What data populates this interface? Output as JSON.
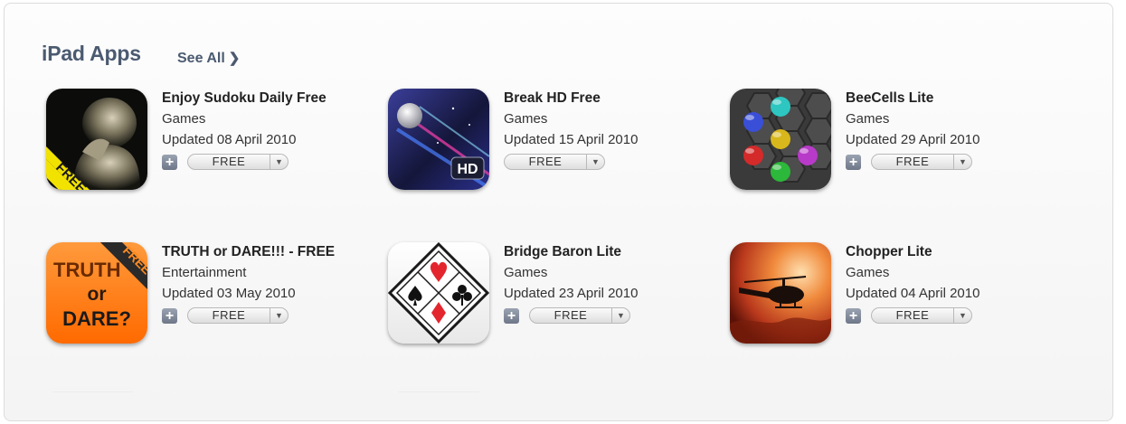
{
  "section": {
    "title": "iPad Apps",
    "see_all": "See All",
    "see_all_icon": "chevron-right-icon"
  },
  "apps": [
    {
      "name": "Enjoy Sudoku Daily Free",
      "category": "Games",
      "updated": "Updated 08 April 2010",
      "price": "FREE",
      "badge": "FREE",
      "has_plus": true
    },
    {
      "name": "Break HD Free",
      "category": "Games",
      "updated": "Updated 15 April 2010",
      "price": "FREE",
      "badge": "HD",
      "has_plus": false
    },
    {
      "name": "BeeCells Lite",
      "category": "Games",
      "updated": "Updated 29 April 2010",
      "price": "FREE",
      "has_plus": true
    },
    {
      "name": "TRUTH or DARE!!! - FREE",
      "category": "Entertainment",
      "updated": "Updated 03 May 2010",
      "price": "FREE",
      "badge": "FREE",
      "icon_words": [
        "TRUTH",
        "or",
        "DARE?"
      ],
      "has_plus": true
    },
    {
      "name": "Bridge Baron Lite",
      "category": "Games",
      "updated": "Updated 23 April 2010",
      "price": "FREE",
      "has_plus": true
    },
    {
      "name": "Chopper Lite",
      "category": "Games",
      "updated": "Updated 04 April 2010",
      "price": "FREE",
      "has_plus": true
    }
  ],
  "colors": {
    "title": "#4b5a70",
    "text": "#333333"
  }
}
